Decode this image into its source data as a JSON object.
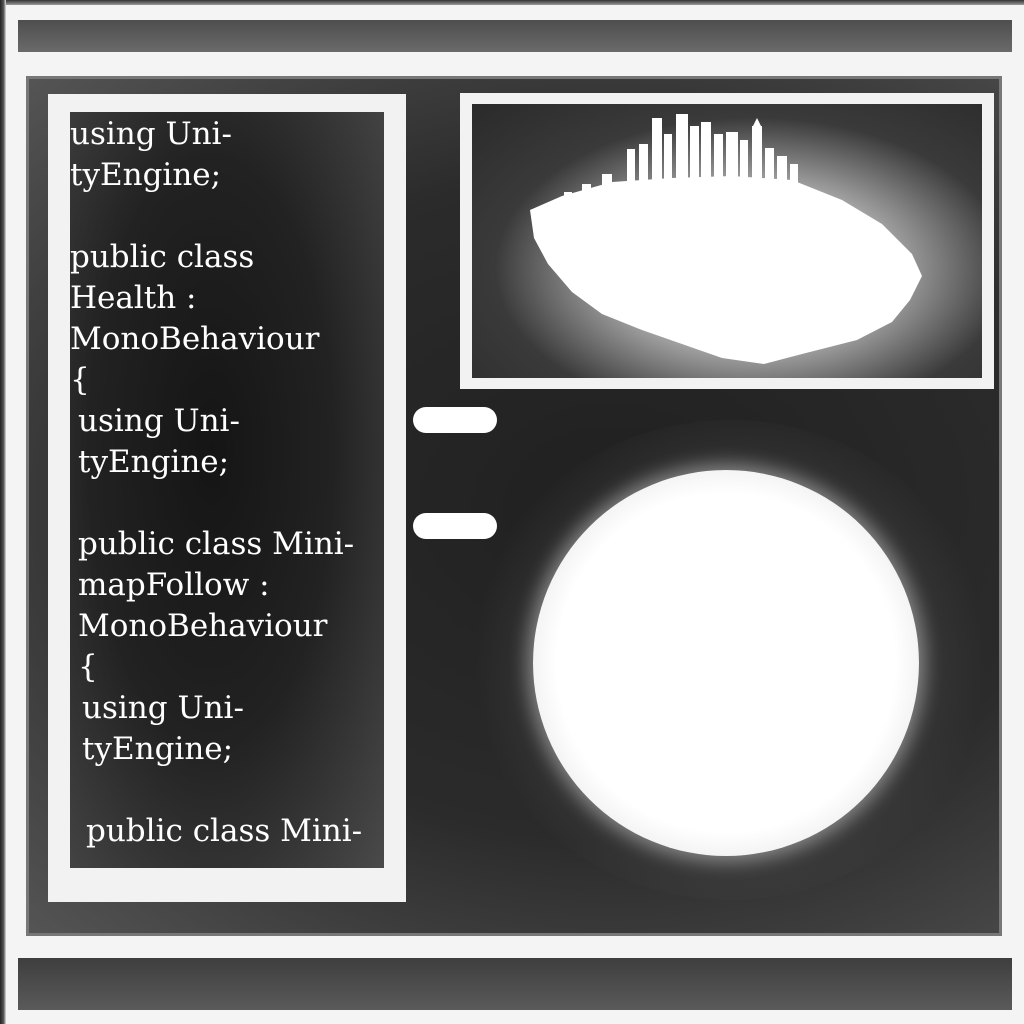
{
  "window": {
    "accent_color": "#ffffff",
    "panel_color": "#2b2b2b"
  },
  "code_editor": {
    "lines": [
      "using Uni-",
      "tyEngine;",
      "",
      "public class",
      "Health :",
      "MonoBehaviour",
      "{",
      "using Uni-",
      "tyEngine;",
      "",
      "public class Mini-",
      "mapFollow :",
      "MonoBehaviour",
      "{",
      "using Uni-",
      "tyEngine;",
      "",
      "public class Mini-"
    ]
  },
  "preview": {
    "icon": "city-island-icon"
  },
  "controls": {
    "icons": [
      "pill-button",
      "pill-button"
    ]
  },
  "scene": {
    "icon": "planet-globe-icon"
  }
}
